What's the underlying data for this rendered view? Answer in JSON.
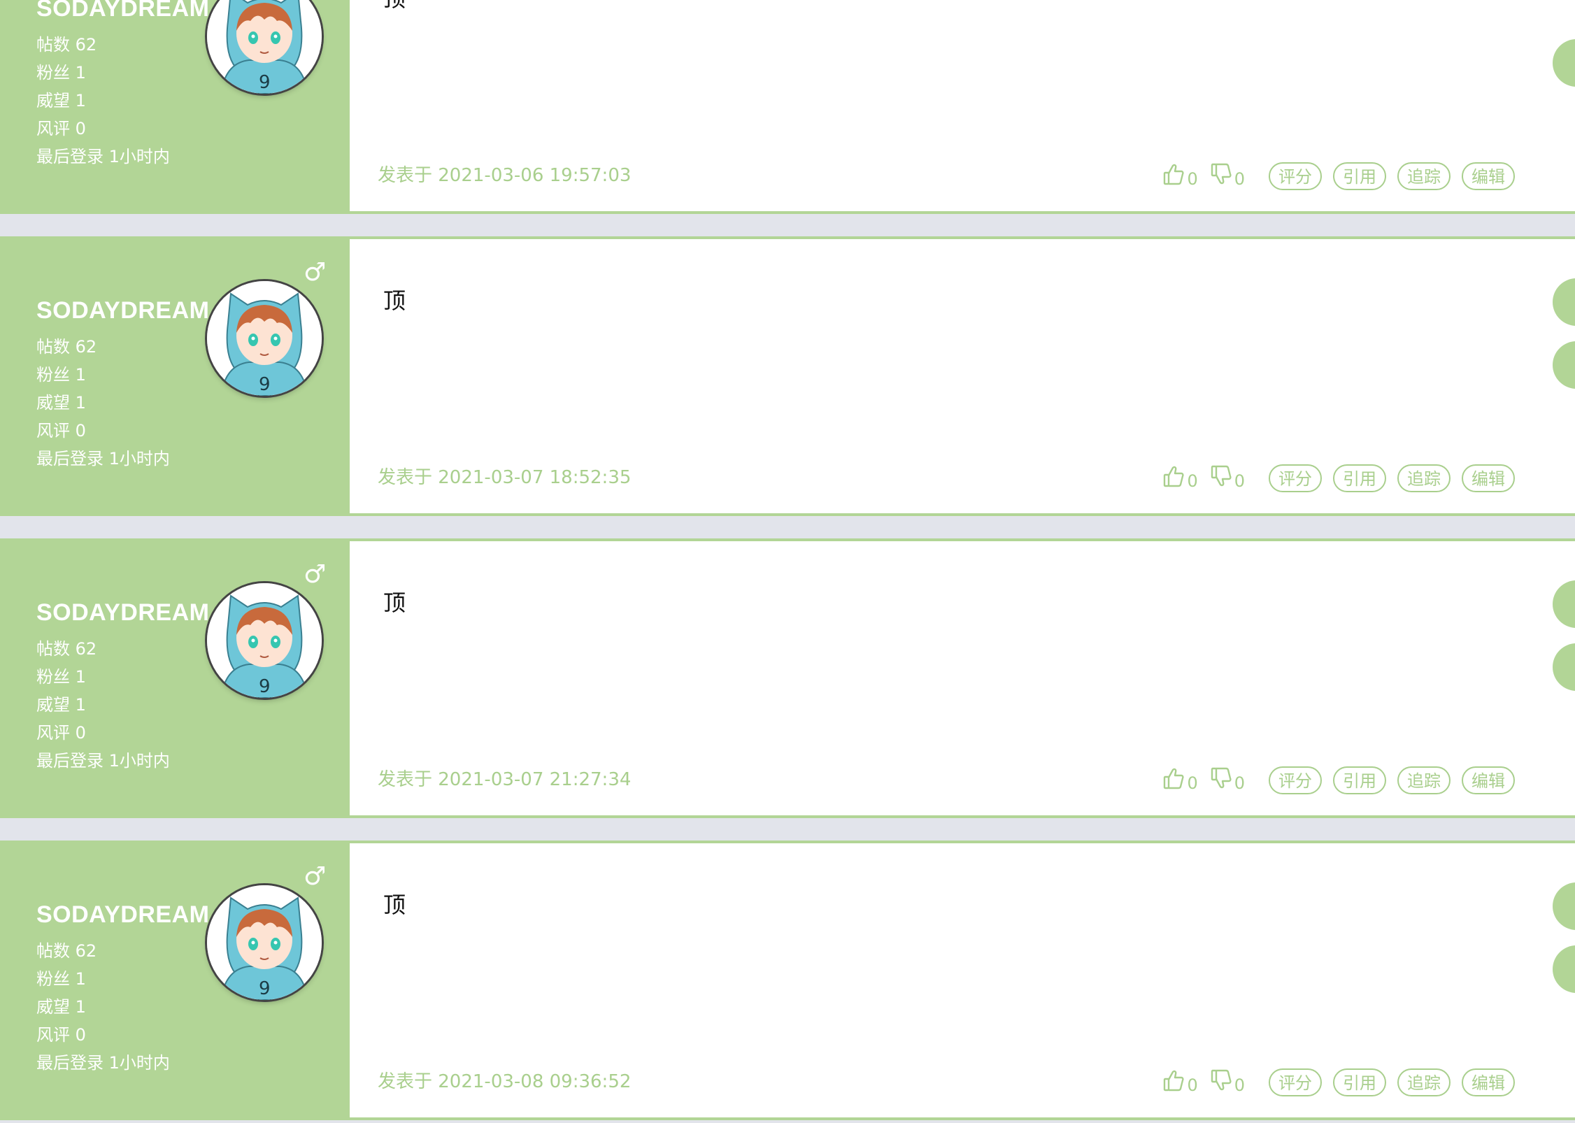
{
  "posts": [
    {
      "username": "SODAYDREAM",
      "gender_icon": "male-icon",
      "stats": {
        "posts": "帖数 62",
        "fans": "粉丝 1",
        "prestige": "威望 1",
        "rating": "风评 0",
        "last_login": "最后登录 1小时内"
      },
      "content": "顶",
      "date": "发表于 2021-03-06 19:57:03",
      "likes": "0",
      "dislikes": "0"
    },
    {
      "username": "SODAYDREAM",
      "gender_icon": "male-icon",
      "stats": {
        "posts": "帖数 62",
        "fans": "粉丝 1",
        "prestige": "威望 1",
        "rating": "风评 0",
        "last_login": "最后登录 1小时内"
      },
      "content": "顶",
      "date": "发表于 2021-03-07 18:52:35",
      "likes": "0",
      "dislikes": "0"
    },
    {
      "username": "SODAYDREAM",
      "gender_icon": "male-icon",
      "stats": {
        "posts": "帖数 62",
        "fans": "粉丝 1",
        "prestige": "威望 1",
        "rating": "风评 0",
        "last_login": "最后登录 1小时内"
      },
      "content": "顶",
      "date": "发表于 2021-03-07 21:27:34",
      "likes": "0",
      "dislikes": "0"
    },
    {
      "username": "SODAYDREAM",
      "gender_icon": "male-icon",
      "stats": {
        "posts": "帖数 62",
        "fans": "粉丝 1",
        "prestige": "威望 1",
        "rating": "风评 0",
        "last_login": "最后登录 1小时内"
      },
      "content": "顶",
      "date": "发表于 2021-03-08 09:36:52",
      "likes": "0",
      "dislikes": "0"
    }
  ],
  "action_labels": {
    "rate": "评分",
    "quote": "引用",
    "track": "追踪",
    "edit": "编辑"
  },
  "colors": {
    "accent_green": "#b2d596",
    "text_green": "#a9cf8d",
    "page_background": "#e2e4eb",
    "avatar_hood": "#6ec6d8",
    "avatar_hair": "#c86a3c"
  }
}
